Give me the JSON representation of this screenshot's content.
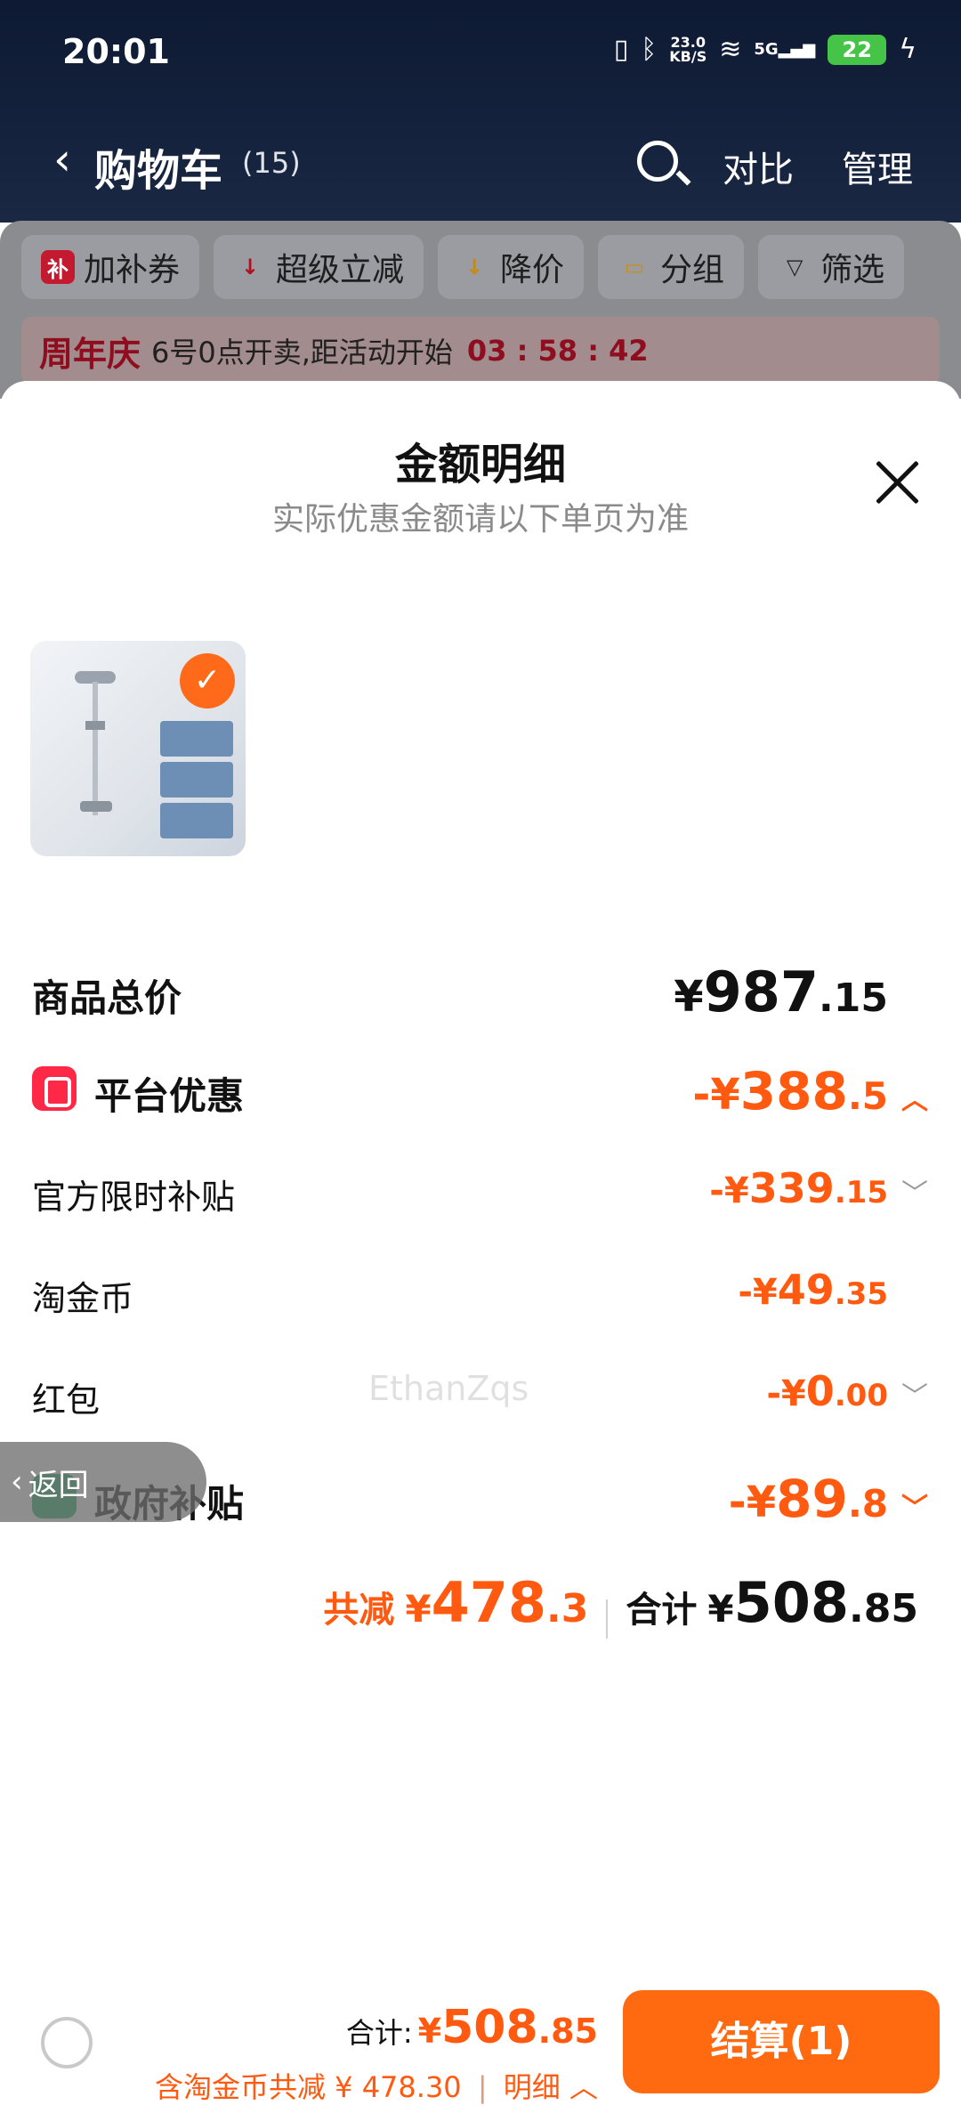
{
  "status_bar": {
    "time": "20:01",
    "net_speed_value": "23.0",
    "net_speed_unit": "KB/S",
    "signal_label": "5G",
    "battery": "22"
  },
  "nav": {
    "title": "购物车",
    "count": "(15)",
    "compare": "对比",
    "manage": "管理"
  },
  "filters": [
    {
      "label": "加补券",
      "icon": "补",
      "color": "#c41a30"
    },
    {
      "label": "超级立减",
      "icon": "↓",
      "color": "#b01020"
    },
    {
      "label": "降价",
      "icon": "↓",
      "color": "#c88a10"
    },
    {
      "label": "分组",
      "icon": "▭",
      "color": "#c89010"
    },
    {
      "label": "筛选",
      "icon": "▽",
      "color": "#222222"
    }
  ],
  "promo": {
    "tag": "周年庆",
    "text": "6号0点开卖,距活动开始",
    "countdown": "03 : 58 : 42"
  },
  "sheet": {
    "title": "金额明细",
    "subtitle": "实际优惠金额请以下单页为准",
    "watermark": "EthanZqs",
    "rows": {
      "total": {
        "label": "商品总价",
        "sym": "¥",
        "int": "987",
        "dec": ".15"
      },
      "platform": {
        "label": "平台优惠",
        "sym": "-¥",
        "int": "388",
        "dec": ".5",
        "chevron": "︿"
      },
      "subsidy": {
        "label": "官方限时补贴",
        "sym": "-¥",
        "int": "339",
        "dec": ".15",
        "chevron": "﹀"
      },
      "taojinbi": {
        "label": "淘金币",
        "sym": "-¥",
        "int": "49",
        "dec": ".35"
      },
      "hongbao": {
        "label": "红包",
        "sym": "-¥",
        "int": "0",
        "dec": ".00",
        "chevron": "﹀"
      },
      "gov": {
        "label": "政府补贴",
        "sym": "-¥",
        "int": "89",
        "dec": ".8",
        "chevron": "﹀"
      }
    },
    "summary": {
      "off_label": "共减",
      "off_sym": "¥",
      "off_int": "478",
      "off_dec": ".3",
      "total_label": "合计",
      "total_sym": "¥",
      "total_int": "508",
      "total_dec": ".85"
    }
  },
  "float_back": {
    "label": "返回"
  },
  "bottom_bar": {
    "total_label": "合计:",
    "total_sym": "¥",
    "total_int": "508",
    "total_dec": ".85",
    "detail_text": "含淘金币共减 ¥ 478.30",
    "detail_sep": "|",
    "detail_link": "明细",
    "detail_chevron": "︿",
    "checkout_label": "结算(1)"
  },
  "colors": {
    "accent": "#ff5a10",
    "checkout": "#ff6a10",
    "platform_badge": "#ff2846",
    "gov_badge": "#11a85a"
  }
}
